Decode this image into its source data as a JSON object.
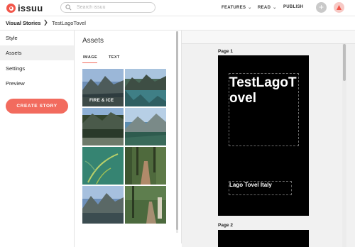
{
  "header": {
    "logo_text": "issuu",
    "search_placeholder": "Search issuu",
    "nav": [
      "FEATURES",
      "READ",
      "PUBLISH"
    ],
    "plus_symbol": "+"
  },
  "breadcrumb": {
    "root": "Visual Stories",
    "separator": "❯",
    "current": "TestLagoTovel"
  },
  "sidebar": {
    "items": [
      {
        "label": "Style",
        "active": false
      },
      {
        "label": "Assets",
        "active": true
      },
      {
        "label": "Settings",
        "active": false
      },
      {
        "label": "Preview",
        "active": false
      }
    ],
    "create_label": "CREATE STORY"
  },
  "assets": {
    "title": "Assets",
    "tabs": [
      "IMAGE",
      "TEXT"
    ],
    "active_tab": "IMAGE",
    "tiles": [
      {
        "label": "FIRE & ICE",
        "icon": "mountain-lake-photo"
      },
      {
        "label": "",
        "icon": "lake-reflection-photo"
      },
      {
        "label": "",
        "icon": "forest-lake-photo"
      },
      {
        "label": "",
        "icon": "lake-shore-photo"
      },
      {
        "label": "",
        "icon": "underwater-plants-photo"
      },
      {
        "label": "",
        "icon": "forest-path-photo"
      },
      {
        "label": "",
        "icon": "mountain-lake-photo"
      },
      {
        "label": "",
        "icon": "forest-trail-photo"
      }
    ]
  },
  "canvas": {
    "pages": [
      {
        "label": "Page 1",
        "title": "TestLagoTovel",
        "subtitle": "Lago Tovel Italy"
      },
      {
        "label": "Page 2"
      }
    ]
  },
  "colors": {
    "brand": "#f26b5e",
    "page_bg": "#000000"
  }
}
